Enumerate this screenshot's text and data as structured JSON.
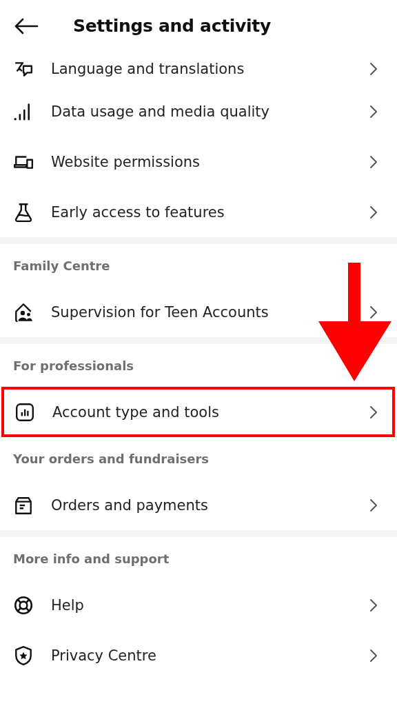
{
  "header": {
    "title": "Settings and activity"
  },
  "sections": [
    {
      "items": [
        {
          "label": "Language and translations",
          "highlighted": false
        },
        {
          "label": "Data usage and media quality",
          "highlighted": false
        },
        {
          "label": "Website permissions",
          "highlighted": false
        },
        {
          "label": "Early access to features",
          "highlighted": false
        }
      ]
    },
    {
      "heading": "Family Centre",
      "items": [
        {
          "label": "Supervision for Teen Accounts",
          "highlighted": false
        }
      ]
    },
    {
      "heading": "For professionals",
      "items": [
        {
          "label": "Account type and tools",
          "highlighted": true
        }
      ]
    },
    {
      "heading": "Your orders and fundraisers",
      "items": [
        {
          "label": "Orders and payments",
          "highlighted": false
        }
      ]
    },
    {
      "heading": "More info and support",
      "items": [
        {
          "label": "Help",
          "highlighted": false
        },
        {
          "label": "Privacy Centre",
          "highlighted": false
        }
      ]
    }
  ]
}
